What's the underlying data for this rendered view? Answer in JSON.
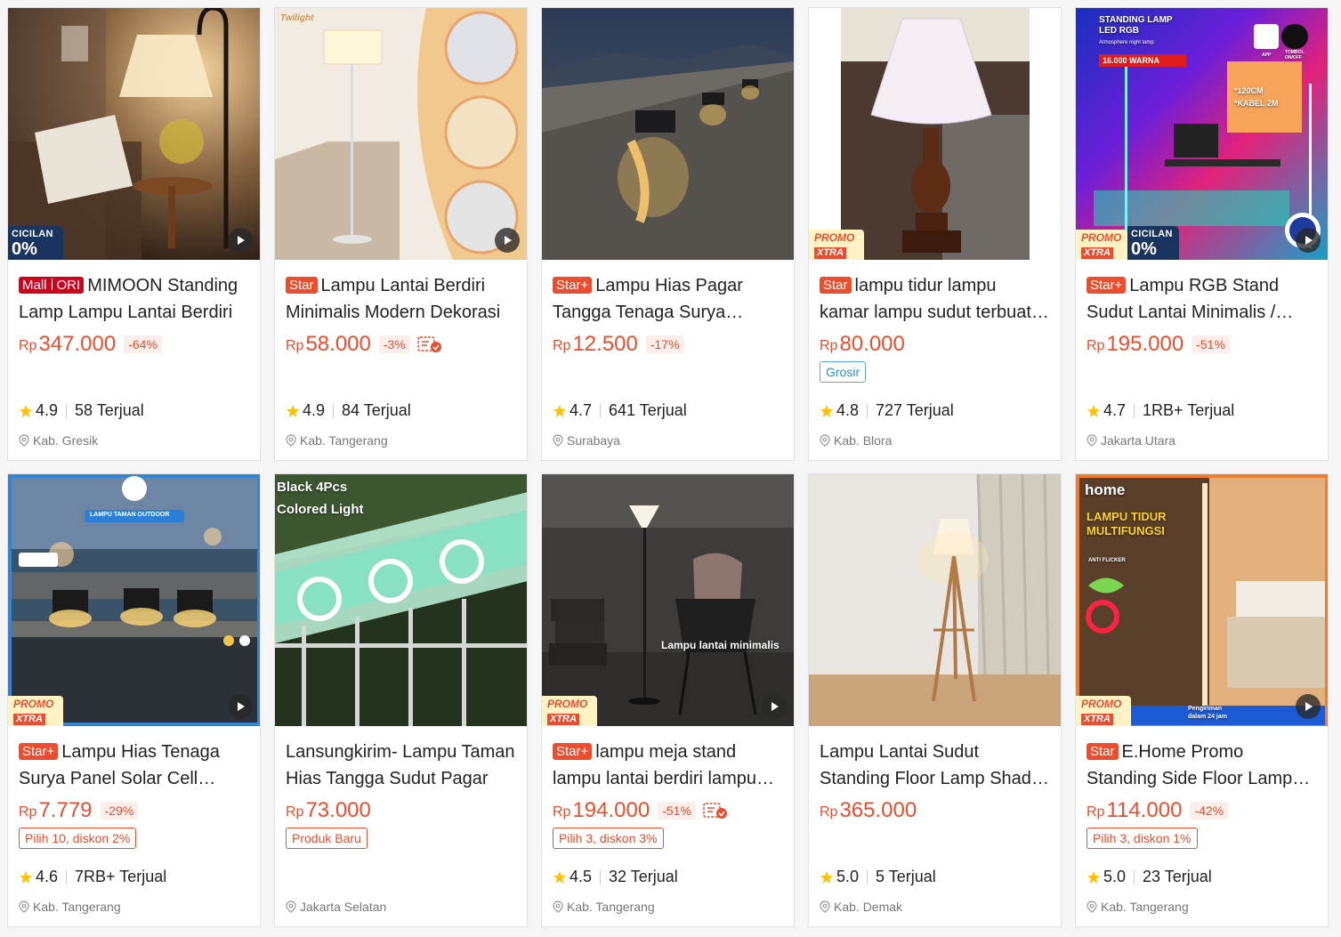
{
  "products": [
    {
      "store_tag": "mall-ori",
      "tag_parts": [
        "Mall",
        "ORI"
      ],
      "title": "MIMOON Standing Lamp Lampu Lantai Berdiri",
      "currency": "Rp",
      "price": "347.000",
      "discount": "-64%",
      "chip": "",
      "cod": false,
      "rating": "4.9",
      "sold": "58 Terjual",
      "location": "Kab. Gresik",
      "badge": "cicilan",
      "video": true
    },
    {
      "store_tag": "star",
      "tag_label": "Star",
      "title": "Lampu Lantai Berdiri Minimalis Modern Dekorasi",
      "currency": "Rp",
      "price": "58.000",
      "discount": "-3%",
      "chip": "",
      "cod": true,
      "rating": "4.9",
      "sold": "84 Terjual",
      "location": "Kab. Tangerang",
      "badge": "",
      "video": true,
      "overlay_brand": "Twilight"
    },
    {
      "store_tag": "star",
      "tag_label": "Star+",
      "title": "Lampu Hias Pagar Tangga Tenaga Surya Outdoor",
      "currency": "Rp",
      "price": "12.500",
      "discount": "-17%",
      "chip": "",
      "cod": false,
      "rating": "4.7",
      "sold": "641 Terjual",
      "location": "Surabaya",
      "badge": "",
      "video": false
    },
    {
      "store_tag": "star",
      "tag_label": "Star",
      "title": "lampu tidur lampu kamar lampu sudut terbuat dari kayu",
      "currency": "Rp",
      "price": "80.000",
      "discount": "",
      "chip": "Grosir",
      "chip_style": "blue",
      "cod": false,
      "rating": "4.8",
      "sold": "727 Terjual",
      "location": "Kab. Blora",
      "badge": "promo",
      "video": false
    },
    {
      "store_tag": "star",
      "tag_label": "Star+",
      "title": "Lampu RGB Stand Sudut Lantai Minimalis / Standing Lamp",
      "currency": "Rp",
      "price": "195.000",
      "discount": "-51%",
      "chip": "",
      "cod": false,
      "rating": "4.7",
      "sold": "1RB+ Terjual",
      "location": "Jakarta Utara",
      "badge": "promo-cicilan",
      "video": true,
      "overlay_heading": "STANDING LAMP\nLED RGB",
      "overlay_sub": "Atmosphere night lamp",
      "overlay_red": "16.000 WARNA",
      "overlay_specs": "*120CM\n*KABEL 2M",
      "overlay_app": "APP",
      "overlay_switch": "TOMBOL\nON/OFF"
    },
    {
      "store_tag": "star",
      "tag_label": "Star+",
      "title": "Lampu Hias Tenaga Surya Panel Solar Cell Tangga",
      "currency": "Rp",
      "price": "7.779",
      "discount": "-29%",
      "chip": "Pilih 10, diskon 2%",
      "chip_style": "red",
      "cod": false,
      "rating": "4.6",
      "sold": "7RB+ Terjual",
      "location": "Kab. Tangerang",
      "badge": "promo",
      "video": true,
      "overlay_banner": "LAMPU TAMAN OUTDOOR"
    },
    {
      "store_tag": "",
      "title": "Lansungkirim- Lampu Taman Hias Tangga Sudut Pagar",
      "currency": "Rp",
      "price": "73.000",
      "discount": "",
      "chip": "Produk Baru",
      "chip_style": "red",
      "cod": false,
      "rating": "",
      "sold": "",
      "location": "Jakarta Selatan",
      "badge": "",
      "video": false,
      "overlay_text": "Black 4Pcs\nColored Light"
    },
    {
      "store_tag": "star",
      "tag_label": "Star+",
      "title": "lampu meja stand lampu lantai berdiri lampu sudut",
      "currency": "Rp",
      "price": "194.000",
      "discount": "-51%",
      "chip": "Pilih 3, diskon 3%",
      "chip_style": "red",
      "cod": true,
      "rating": "4.5",
      "sold": "32 Terjual",
      "location": "Kab. Tangerang",
      "badge": "promo",
      "video": true,
      "overlay_caption": "Lampu lantai minimalis"
    },
    {
      "store_tag": "",
      "title": "Lampu Lantai Sudut Standing Floor Lamp Shade Kayu",
      "currency": "Rp",
      "price": "365.000",
      "discount": "",
      "chip": "",
      "cod": false,
      "rating": "5.0",
      "sold": "5 Terjual",
      "location": "Kab. Demak",
      "badge": "",
      "video": false
    },
    {
      "store_tag": "star",
      "tag_label": "Star",
      "title": "E.Home Promo Standing Side Floor Lamp LED",
      "currency": "Rp",
      "price": "114.000",
      "discount": "-42%",
      "chip": "Pilih 3, diskon 1%",
      "chip_style": "red",
      "cod": false,
      "rating": "5.0",
      "sold": "23 Terjual",
      "location": "Kab. Tangerang",
      "badge": "promo",
      "video": true,
      "overlay_brand": "home",
      "overlay_heading": "LAMPU TIDUR\nMULTIFUNGSI",
      "overlay_sub": "ANTI FLICKER",
      "overlay_ship": "Pengiriman\ndalam 24 jam"
    }
  ],
  "badges": {
    "cicilan_top": "CICILAN",
    "cicilan_bottom": "0%",
    "promo_top": "PROMO",
    "promo_bottom": "XTRA"
  },
  "colors": {
    "accent": "#ee4d2d",
    "mall": "#d0011b",
    "grosir": "#2f8ed1"
  }
}
